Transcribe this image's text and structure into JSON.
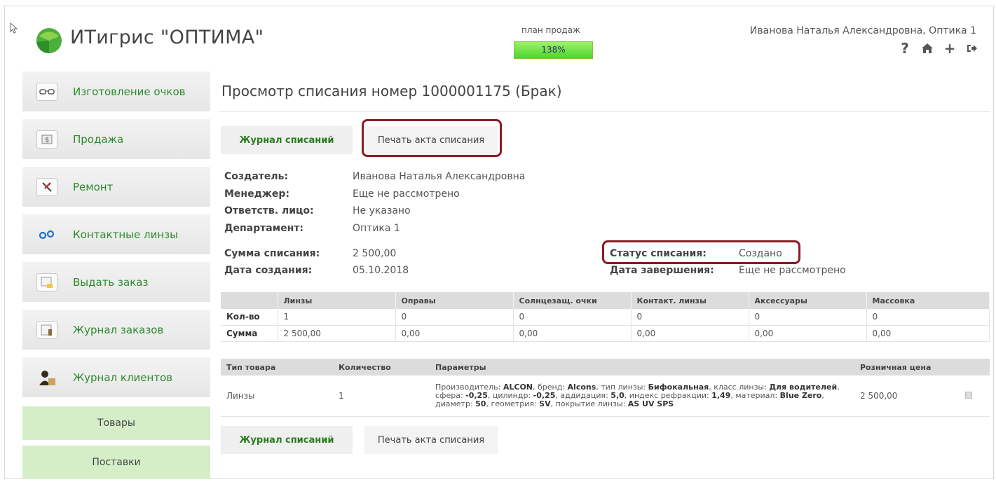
{
  "header": {
    "app_title": "ИТигрис \"ОПТИМА\"",
    "plan_label": "план продаж",
    "plan_value": "138%",
    "plan_fill_fraction": 1.0,
    "user": "Иванова Наталья Александровна, Оптика 1",
    "icons": [
      "help-icon",
      "home-icon",
      "add-icon",
      "logout-icon"
    ]
  },
  "sidebar": {
    "items": [
      {
        "label": "Изготовление очков",
        "icon": "glasses-icon"
      },
      {
        "label": "Продажа",
        "icon": "money-icon"
      },
      {
        "label": "Ремонт",
        "icon": "repair-tools-icon"
      },
      {
        "label": "Контактные линзы",
        "icon": "contact-lenses-icon"
      },
      {
        "label": "Выдать заказ",
        "icon": "deliver-order-icon"
      },
      {
        "label": "Журнал заказов",
        "icon": "orders-journal-icon"
      },
      {
        "label": "Журнал клиентов",
        "icon": "clients-icon"
      }
    ],
    "green_items": [
      "Товары",
      "Поставки"
    ]
  },
  "main": {
    "title": "Просмотр списания номер 1000001175 (Брак)",
    "buttons": {
      "journal": "Журнал списаний",
      "print": "Печать акта списания"
    },
    "info": {
      "creator_label": "Создатель:",
      "creator": "Иванова Наталья Александровна",
      "manager_label": "Менеджер:",
      "manager": "Еще не рассмотрено",
      "responsible_label": "Ответств. лицо:",
      "responsible": "Не указано",
      "department_label": "Департамент:",
      "department": "Оптика 1",
      "sum_label": "Сумма списания:",
      "sum": "2 500,00",
      "created_label": "Дата создания:",
      "created": "05.10.2018",
      "status_label": "Статус списания:",
      "status": "Создано",
      "finished_label": "Дата завершения:",
      "finished": "Еще не рассмотрено"
    },
    "totals": {
      "columns": [
        "Линзы",
        "Оправы",
        "Солнцезащ. очки",
        "Контакт. линзы",
        "Аксессуары",
        "Массовка"
      ],
      "rows": [
        {
          "label": "Кол-во",
          "values": [
            "1",
            "0",
            "0",
            "0",
            "0",
            "0"
          ]
        },
        {
          "label": "Сумма",
          "values": [
            "2 500,00",
            "0,00",
            "0,00",
            "0,00",
            "0,00",
            "0,00"
          ]
        }
      ]
    },
    "items": {
      "columns": [
        "Тип товара",
        "Количество",
        "Параметры",
        "Розничная цена"
      ],
      "rows": [
        {
          "type": "Линзы",
          "qty": "1",
          "params": [
            [
              "Производитель: ",
              "ALCON"
            ],
            [
              ", бренд: ",
              "Alcons"
            ],
            [
              ", тип линзы: ",
              "Бифокальная"
            ],
            [
              ", класс линзы: ",
              "Для водителей"
            ],
            [
              ", сфера: ",
              "-0,25"
            ],
            [
              ", цилиндр: ",
              "-0,25"
            ],
            [
              ", аддидация: ",
              "5,0"
            ],
            [
              ", индекс рефракции: ",
              "1,49"
            ],
            [
              ", материал: ",
              "Blue Zero"
            ],
            [
              ", диаметр: ",
              "50"
            ],
            [
              ", геометрия: ",
              "SV"
            ],
            [
              ", покрытие линзы: ",
              "AS UV SPS"
            ]
          ],
          "price": "2 500,00"
        }
      ]
    }
  }
}
